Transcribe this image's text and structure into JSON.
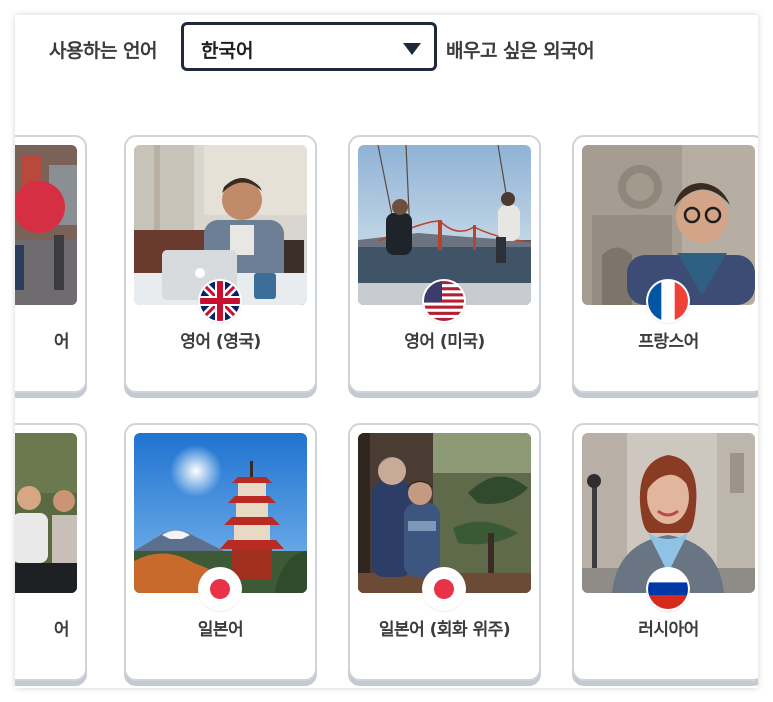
{
  "header": {
    "native_label": "사용하는 언어",
    "native_select_value": "한국어",
    "learn_label": "배우고 싶은 외국어"
  },
  "courses": [
    {
      "name": "어",
      "flag": "none"
    },
    {
      "name": "영어 (영국)",
      "flag": "uk-flag"
    },
    {
      "name": "영어 (미국)",
      "flag": "us-flag"
    },
    {
      "name": "프랑스어",
      "flag": "france-flag"
    },
    {
      "name": "어",
      "flag": "none"
    },
    {
      "name": "일본어",
      "flag": "japan-flag"
    },
    {
      "name": "일본어 (회화 위주)",
      "flag": "japan-flag"
    },
    {
      "name": "러시아어",
      "flag": "russia-flag"
    }
  ],
  "colors": {
    "select_border": "#1f2937",
    "card_border": "#cfd3dc",
    "card_shadow": "#c5c9d2",
    "text": "#3c3c3c"
  }
}
